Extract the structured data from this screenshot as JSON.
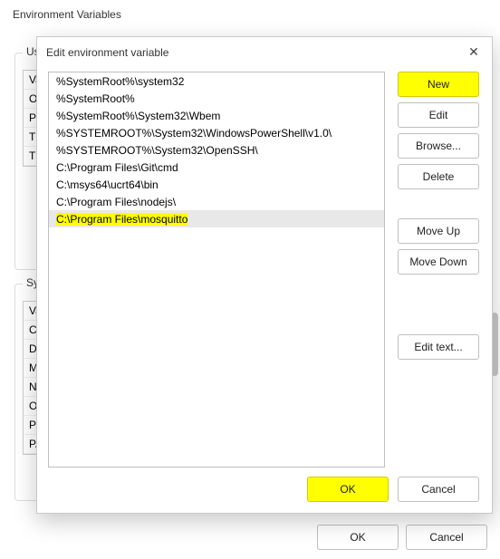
{
  "background": {
    "title": "Environment Variables",
    "user_section_label": "User",
    "sys_section_label": "Syst",
    "user_rows": [
      "Va",
      "Or",
      "Pa",
      "TE",
      "TM"
    ],
    "sys_rows": [
      "Va",
      "Co",
      "Dr",
      "MC",
      "NU",
      "OS",
      "Pa",
      "PA"
    ],
    "ok": "OK",
    "cancel": "Cancel"
  },
  "edit": {
    "title": "Edit environment variable",
    "paths": [
      "%SystemRoot%\\system32",
      "%SystemRoot%",
      "%SystemRoot%\\System32\\Wbem",
      "%SYSTEMROOT%\\System32\\WindowsPowerShell\\v1.0\\",
      "%SYSTEMROOT%\\System32\\OpenSSH\\",
      "C:\\Program Files\\Git\\cmd",
      "C:\\msys64\\ucrt64\\bin",
      "C:\\Program Files\\nodejs\\",
      "C:\\Program Files\\mosquitto"
    ],
    "selected_index": 8,
    "highlight_index": 8,
    "buttons": {
      "new": "New",
      "edit": "Edit",
      "browse": "Browse...",
      "delete": "Delete",
      "moveup": "Move Up",
      "movedown": "Move Down",
      "edittext": "Edit text...",
      "ok": "OK",
      "cancel": "Cancel"
    }
  },
  "close_glyph": "✕"
}
